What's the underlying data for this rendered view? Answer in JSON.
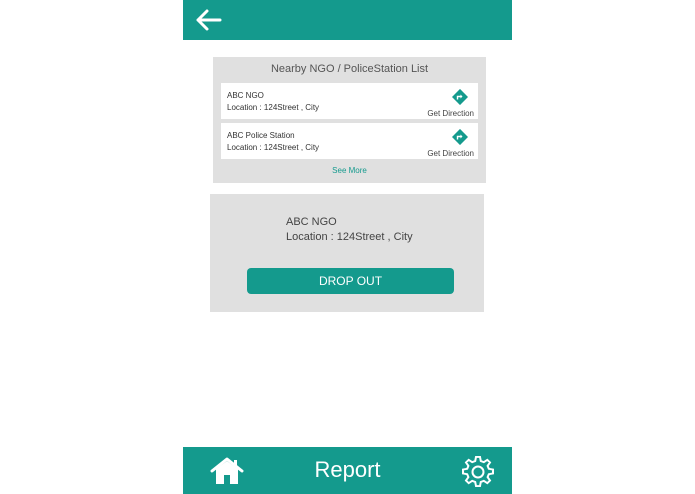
{
  "colors": {
    "accent": "#149a8d",
    "panel": "#e0e0e0",
    "background": "#ffffff"
  },
  "header": {
    "back_icon": "arrow-left-icon"
  },
  "nearby_list": {
    "title": "Nearby NGO / PoliceStation List",
    "items": [
      {
        "name": "ABC NGO",
        "location": "Location : 124Street , City",
        "action_label": "Get Direction",
        "icon": "direction-icon"
      },
      {
        "name": "ABC Police Station",
        "location": "Location : 124Street , City",
        "action_label": "Get Direction",
        "icon": "direction-icon"
      }
    ],
    "see_more_label": "See More"
  },
  "selected": {
    "name": "ABC NGO",
    "location": "Location : 124Street , City",
    "button_label": "DROP OUT"
  },
  "footer": {
    "title": "Report",
    "home_icon": "home-icon",
    "settings_icon": "gear-icon"
  }
}
